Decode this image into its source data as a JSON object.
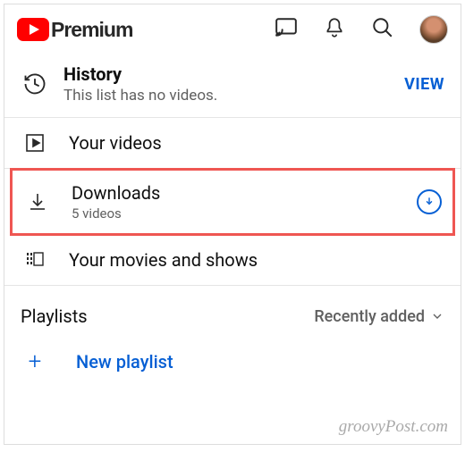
{
  "brand": "Premium",
  "history": {
    "title": "History",
    "subtitle": "This list has no videos.",
    "view": "VIEW"
  },
  "rows": {
    "yourVideos": "Your videos",
    "downloads": {
      "title": "Downloads",
      "subtitle": "5 videos"
    },
    "movies": "Your movies and shows"
  },
  "playlists": {
    "header": "Playlists",
    "sort": "Recently added",
    "new": "New playlist"
  },
  "watermark": "groovyPost.com"
}
